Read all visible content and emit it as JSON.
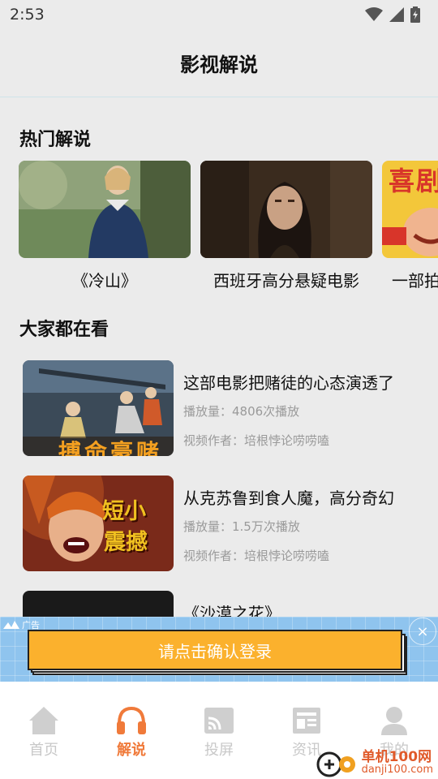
{
  "status_bar": {
    "time": "2:53",
    "icons": [
      "wifi-icon",
      "cellular-signal-icon",
      "battery-charging-icon"
    ]
  },
  "header": {
    "title": "影视解说"
  },
  "hot_section": {
    "title": "热门解说",
    "items": [
      {
        "title": "《冷山》"
      },
      {
        "title": "西班牙高分悬疑电影"
      },
      {
        "title": "一部拍"
      }
    ],
    "third_thumb_text": "喜剧"
  },
  "popular_section": {
    "title": "大家都在看",
    "items": [
      {
        "title": "这部电影把赌徒的心态演透了",
        "views": "播放量：4806次播放",
        "author": "视频作者：培根悖论唠唠嗑",
        "thumb_text": "搏命豪赌"
      },
      {
        "title": "从克苏鲁到食人魔，高分奇幻",
        "views": "播放量：1.5万次播放",
        "author": "视频作者：培根悖论唠唠嗑",
        "thumb_text": [
          "短小",
          "震撼"
        ]
      },
      {
        "title": "《沙漠之花》"
      }
    ]
  },
  "ad": {
    "label": "广告",
    "button_text": "请点击确认登录",
    "close": "×"
  },
  "tab_bar": {
    "tabs": [
      {
        "label": "首页",
        "icon": "home-icon",
        "active": false
      },
      {
        "label": "解说",
        "icon": "headphones-icon",
        "active": true
      },
      {
        "label": "投屏",
        "icon": "cast-icon",
        "active": false
      },
      {
        "label": "资讯",
        "icon": "news-icon",
        "active": false
      },
      {
        "label": "我的",
        "icon": "user-icon",
        "active": false
      }
    ]
  },
  "watermark": {
    "main": "单机100网",
    "sub": "danji100.com"
  },
  "colors": {
    "accent": "#f07a3a",
    "ad_button": "#fbb12d",
    "ad_bg": "#8fc4ee",
    "inactive_tab": "#c8c8c8",
    "meta_text": "#9a9a9a"
  }
}
